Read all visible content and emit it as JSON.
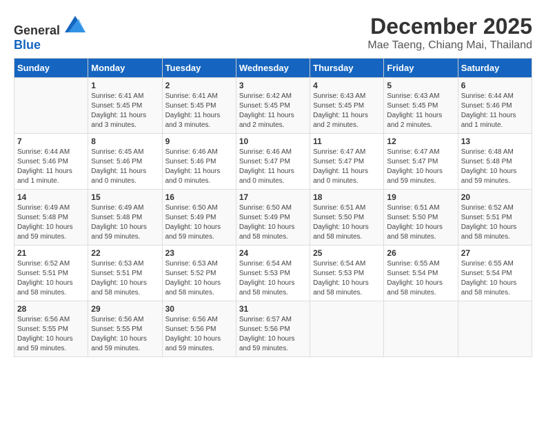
{
  "logo": {
    "general": "General",
    "blue": "Blue"
  },
  "title": "December 2025",
  "subtitle": "Mae Taeng, Chiang Mai, Thailand",
  "days_of_week": [
    "Sunday",
    "Monday",
    "Tuesday",
    "Wednesday",
    "Thursday",
    "Friday",
    "Saturday"
  ],
  "weeks": [
    [
      {
        "day": "",
        "info": ""
      },
      {
        "day": "1",
        "info": "Sunrise: 6:41 AM\nSunset: 5:45 PM\nDaylight: 11 hours and 3 minutes."
      },
      {
        "day": "2",
        "info": "Sunrise: 6:41 AM\nSunset: 5:45 PM\nDaylight: 11 hours and 3 minutes."
      },
      {
        "day": "3",
        "info": "Sunrise: 6:42 AM\nSunset: 5:45 PM\nDaylight: 11 hours and 2 minutes."
      },
      {
        "day": "4",
        "info": "Sunrise: 6:43 AM\nSunset: 5:45 PM\nDaylight: 11 hours and 2 minutes."
      },
      {
        "day": "5",
        "info": "Sunrise: 6:43 AM\nSunset: 5:45 PM\nDaylight: 11 hours and 2 minutes."
      },
      {
        "day": "6",
        "info": "Sunrise: 6:44 AM\nSunset: 5:46 PM\nDaylight: 11 hours and 1 minute."
      }
    ],
    [
      {
        "day": "7",
        "info": "Sunrise: 6:44 AM\nSunset: 5:46 PM\nDaylight: 11 hours and 1 minute."
      },
      {
        "day": "8",
        "info": "Sunrise: 6:45 AM\nSunset: 5:46 PM\nDaylight: 11 hours and 0 minutes."
      },
      {
        "day": "9",
        "info": "Sunrise: 6:46 AM\nSunset: 5:46 PM\nDaylight: 11 hours and 0 minutes."
      },
      {
        "day": "10",
        "info": "Sunrise: 6:46 AM\nSunset: 5:47 PM\nDaylight: 11 hours and 0 minutes."
      },
      {
        "day": "11",
        "info": "Sunrise: 6:47 AM\nSunset: 5:47 PM\nDaylight: 11 hours and 0 minutes."
      },
      {
        "day": "12",
        "info": "Sunrise: 6:47 AM\nSunset: 5:47 PM\nDaylight: 10 hours and 59 minutes."
      },
      {
        "day": "13",
        "info": "Sunrise: 6:48 AM\nSunset: 5:48 PM\nDaylight: 10 hours and 59 minutes."
      }
    ],
    [
      {
        "day": "14",
        "info": "Sunrise: 6:49 AM\nSunset: 5:48 PM\nDaylight: 10 hours and 59 minutes."
      },
      {
        "day": "15",
        "info": "Sunrise: 6:49 AM\nSunset: 5:48 PM\nDaylight: 10 hours and 59 minutes."
      },
      {
        "day": "16",
        "info": "Sunrise: 6:50 AM\nSunset: 5:49 PM\nDaylight: 10 hours and 59 minutes."
      },
      {
        "day": "17",
        "info": "Sunrise: 6:50 AM\nSunset: 5:49 PM\nDaylight: 10 hours and 58 minutes."
      },
      {
        "day": "18",
        "info": "Sunrise: 6:51 AM\nSunset: 5:50 PM\nDaylight: 10 hours and 58 minutes."
      },
      {
        "day": "19",
        "info": "Sunrise: 6:51 AM\nSunset: 5:50 PM\nDaylight: 10 hours and 58 minutes."
      },
      {
        "day": "20",
        "info": "Sunrise: 6:52 AM\nSunset: 5:51 PM\nDaylight: 10 hours and 58 minutes."
      }
    ],
    [
      {
        "day": "21",
        "info": "Sunrise: 6:52 AM\nSunset: 5:51 PM\nDaylight: 10 hours and 58 minutes."
      },
      {
        "day": "22",
        "info": "Sunrise: 6:53 AM\nSunset: 5:51 PM\nDaylight: 10 hours and 58 minutes."
      },
      {
        "day": "23",
        "info": "Sunrise: 6:53 AM\nSunset: 5:52 PM\nDaylight: 10 hours and 58 minutes."
      },
      {
        "day": "24",
        "info": "Sunrise: 6:54 AM\nSunset: 5:53 PM\nDaylight: 10 hours and 58 minutes."
      },
      {
        "day": "25",
        "info": "Sunrise: 6:54 AM\nSunset: 5:53 PM\nDaylight: 10 hours and 58 minutes."
      },
      {
        "day": "26",
        "info": "Sunrise: 6:55 AM\nSunset: 5:54 PM\nDaylight: 10 hours and 58 minutes."
      },
      {
        "day": "27",
        "info": "Sunrise: 6:55 AM\nSunset: 5:54 PM\nDaylight: 10 hours and 58 minutes."
      }
    ],
    [
      {
        "day": "28",
        "info": "Sunrise: 6:56 AM\nSunset: 5:55 PM\nDaylight: 10 hours and 59 minutes."
      },
      {
        "day": "29",
        "info": "Sunrise: 6:56 AM\nSunset: 5:55 PM\nDaylight: 10 hours and 59 minutes."
      },
      {
        "day": "30",
        "info": "Sunrise: 6:56 AM\nSunset: 5:56 PM\nDaylight: 10 hours and 59 minutes."
      },
      {
        "day": "31",
        "info": "Sunrise: 6:57 AM\nSunset: 5:56 PM\nDaylight: 10 hours and 59 minutes."
      },
      {
        "day": "",
        "info": ""
      },
      {
        "day": "",
        "info": ""
      },
      {
        "day": "",
        "info": ""
      }
    ]
  ]
}
